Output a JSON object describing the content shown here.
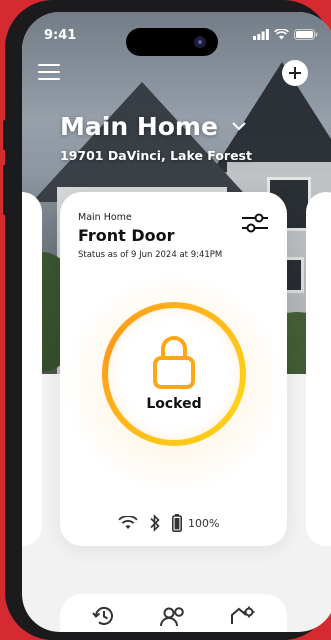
{
  "status_bar": {
    "time": "9:41"
  },
  "header": {
    "home_name": "Main Home",
    "address": "19701 DaVinci, Lake Forest"
  },
  "lock_card": {
    "home_label": "Main Home",
    "device_name": "Front Door",
    "status_as_of": "Status as of 9 Jun 2024 at 9:41PM",
    "lock_state": "Locked",
    "battery_percent": "100%"
  },
  "colors": {
    "brand_red": "#d42a30",
    "lock_ring": "#ffb51a"
  },
  "icons": {
    "menu": "hamburger-icon",
    "add": "plus-icon",
    "dropdown": "chevron-down-icon",
    "settings": "sliders-icon",
    "lock": "padlock-icon",
    "wifi": "wifi-icon",
    "bluetooth": "bluetooth-icon",
    "battery": "battery-icon",
    "history": "history-icon",
    "users": "users-icon",
    "device_settings": "gear-icon"
  }
}
